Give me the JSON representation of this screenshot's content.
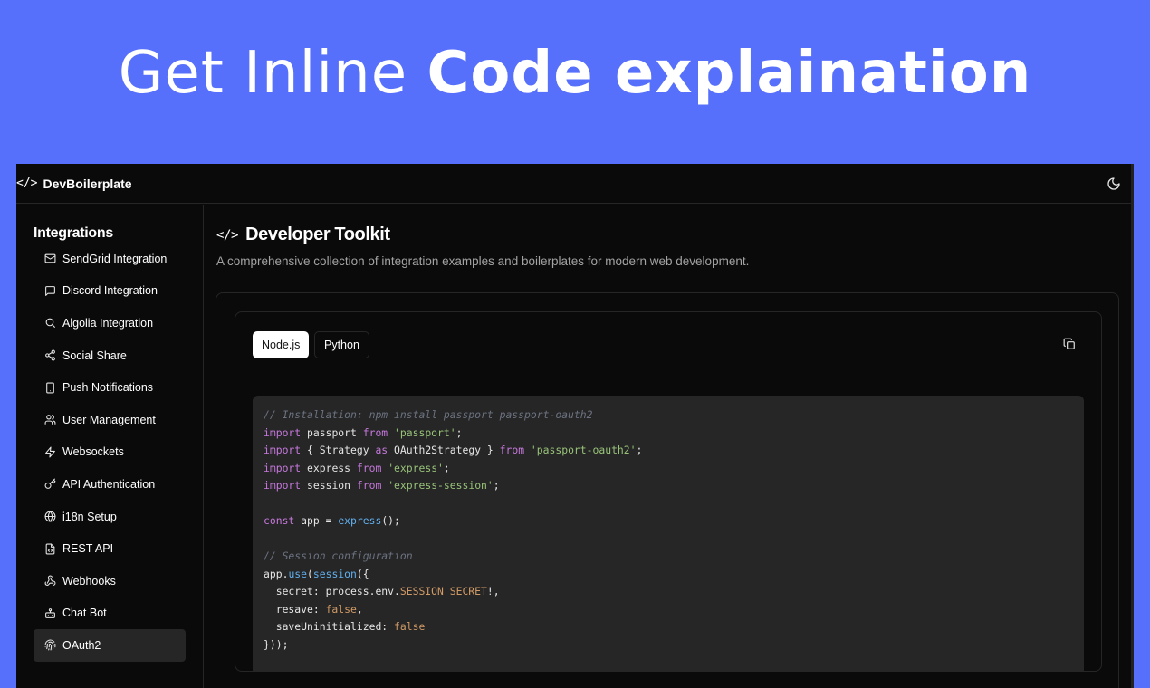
{
  "hero": {
    "light": "Get Inline",
    "bold": "Code explaination"
  },
  "brand": {
    "name": "DevBoilerplate"
  },
  "sidebar": {
    "title": "Integrations",
    "items": [
      {
        "label": "SendGrid Integration",
        "icon": "mail-icon"
      },
      {
        "label": "Discord Integration",
        "icon": "message-square-icon"
      },
      {
        "label": "Algolia Integration",
        "icon": "search-icon"
      },
      {
        "label": "Social Share",
        "icon": "share-icon"
      },
      {
        "label": "Push Notifications",
        "icon": "smartphone-icon"
      },
      {
        "label": "User Management",
        "icon": "users-icon"
      },
      {
        "label": "Websockets",
        "icon": "zap-icon"
      },
      {
        "label": "API Authentication",
        "icon": "key-icon"
      },
      {
        "label": "i18n Setup",
        "icon": "globe-icon"
      },
      {
        "label": "REST API",
        "icon": "file-code-icon"
      },
      {
        "label": "Webhooks",
        "icon": "webhook-icon"
      },
      {
        "label": "Chat Bot",
        "icon": "bot-icon"
      },
      {
        "label": "OAuth2",
        "icon": "fingerprint-icon",
        "active": true
      }
    ]
  },
  "main": {
    "title": "Developer Toolkit",
    "description": "A comprehensive collection of integration examples and boilerplates for modern web development.",
    "tabs": [
      {
        "label": "Node.js",
        "active": true
      },
      {
        "label": "Python",
        "active": false
      }
    ]
  },
  "code": {
    "language": "javascript",
    "lines": [
      "// Installation: npm install passport passport-oauth2",
      "import passport from 'passport';",
      "import { Strategy as OAuth2Strategy } from 'passport-oauth2';",
      "import express from 'express';",
      "import session from 'express-session';",
      "",
      "const app = express();",
      "",
      "// Session configuration",
      "app.use(session({",
      "  secret: process.env.SESSION_SECRET!,",
      "  resave: false,",
      "  saveUninitialized: false",
      "}));"
    ]
  },
  "colors": {
    "background": "#5770fb",
    "app_bg": "#0a0a0a",
    "code_bg": "#262626",
    "keyword": "#c678dd",
    "string": "#98c379",
    "function": "#61afef",
    "literal": "#d19a66",
    "comment": "#6b7280"
  }
}
